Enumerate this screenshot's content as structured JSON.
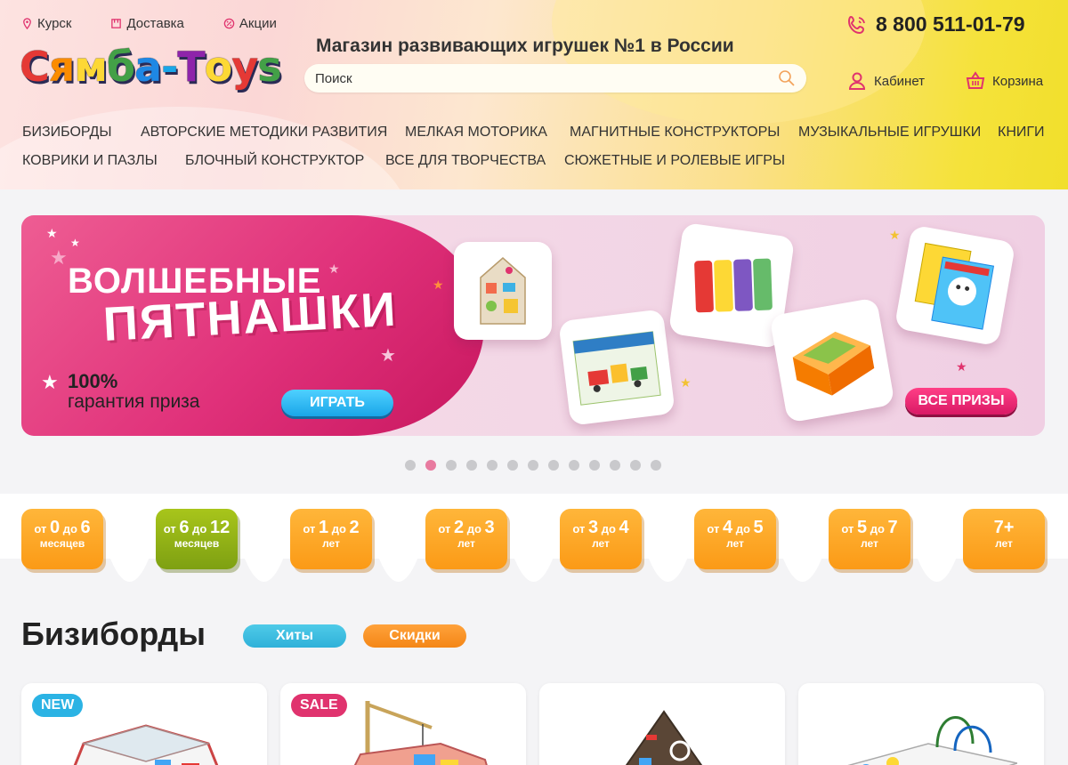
{
  "topbar": {
    "city": "Курск",
    "delivery": "Доставка",
    "promo": "Акции"
  },
  "logo": {
    "text_part1": "Сямба",
    "dash": "-",
    "text_part2": "Toys"
  },
  "header": {
    "tagline": "Магазин развивающих игрушек №1 в России",
    "phone": "8 800 511-01-79",
    "cabinet": "Кабинет",
    "cart": "Корзина"
  },
  "search": {
    "placeholder": "Поиск"
  },
  "nav": {
    "row1": [
      "БИЗИБОРДЫ",
      "АВТОРСКИЕ МЕТОДИКИ РАЗВИТИЯ",
      "МЕЛКАЯ МОТОРИКА",
      "МАГНИТНЫЕ КОНСТРУКТОРЫ",
      "МУЗЫКАЛЬНЫЕ ИГРУШКИ",
      "КНИГИ"
    ],
    "row2": [
      "КОВРИКИ И ПАЗЛЫ",
      "БЛОЧНЫЙ КОНСТРУКТОР",
      "ВСЕ ДЛЯ ТВОРЧЕСТВА",
      "СЮЖЕТНЫЕ И РОЛЕВЫЕ ИГРЫ"
    ]
  },
  "banner": {
    "title1": "ВОЛШЕБНЫЕ",
    "title2": "ПЯТНАШКИ",
    "guarantee_pct": "100%",
    "guarantee_text": "гарантия приза",
    "play_button": "ИГРАТЬ",
    "prizes_button": "ВСЕ ПРИЗЫ"
  },
  "carousel": {
    "total": 13,
    "active": 2
  },
  "ages": [
    {
      "prefix": "от",
      "from": "0",
      "mid": "до",
      "to": "6",
      "unit": "месяцев",
      "color": "orange"
    },
    {
      "prefix": "от",
      "from": "6",
      "mid": "до",
      "to": "12",
      "unit": "месяцев",
      "color": "green"
    },
    {
      "prefix": "от",
      "from": "1",
      "mid": "до",
      "to": "2",
      "unit": "лет",
      "color": "orange"
    },
    {
      "prefix": "от",
      "from": "2",
      "mid": "до",
      "to": "3",
      "unit": "лет",
      "color": "orange"
    },
    {
      "prefix": "от",
      "from": "3",
      "mid": "до",
      "to": "4",
      "unit": "лет",
      "color": "orange"
    },
    {
      "prefix": "от",
      "from": "4",
      "mid": "до",
      "to": "5",
      "unit": "лет",
      "color": "orange"
    },
    {
      "prefix": "от",
      "from": "5",
      "mid": "до",
      "to": "7",
      "unit": "лет",
      "color": "orange"
    },
    {
      "prefix": "",
      "from": "7+",
      "mid": "",
      "to": "",
      "unit": "лет",
      "color": "orange"
    }
  ],
  "section": {
    "title": "Бизиборды",
    "tab_hits": "Хиты",
    "tab_sale": "Скидки"
  },
  "products": [
    {
      "badge": "NEW",
      "badge_type": "new"
    },
    {
      "badge": "SALE",
      "badge_type": "sale"
    },
    {
      "badge": "",
      "badge_type": ""
    },
    {
      "badge": "",
      "badge_type": ""
    }
  ]
}
